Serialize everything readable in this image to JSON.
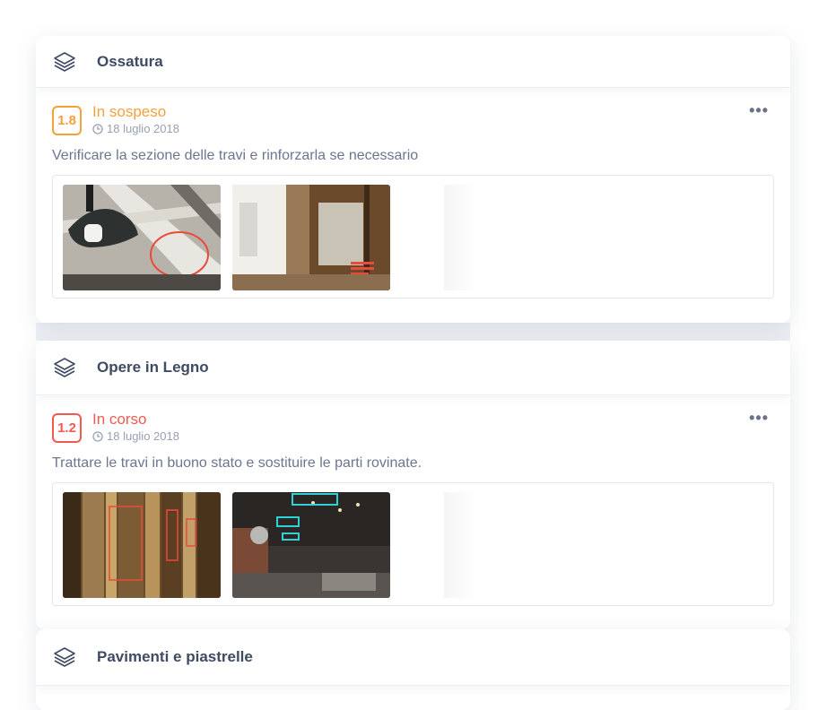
{
  "sections": [
    {
      "title": "Ossatura",
      "item": {
        "code": "1.8",
        "status": "In sospeso",
        "status_color": "#f5a13a",
        "date": "18 luglio 2018",
        "description": "Verificare la sezione delle travi e rinforzarla se necessario",
        "photos": [
          "beam-lamp-photo",
          "renovation-room-photo"
        ]
      }
    },
    {
      "title": "Opere in Legno",
      "item": {
        "code": "1.2",
        "status": "In corso",
        "status_color": "#f25a4d",
        "date": "18 luglio 2018",
        "description": "Trattare le travi in buono stato e sostituire le parti rovinate.",
        "photos": [
          "wooden-beams-photo",
          "loft-interior-photo"
        ]
      }
    },
    {
      "title": "Pavimenti e piastrelle"
    }
  ],
  "icons": {
    "section": "layers-icon",
    "date": "clock-icon",
    "menu": "more-icon"
  },
  "more_label": "•••"
}
